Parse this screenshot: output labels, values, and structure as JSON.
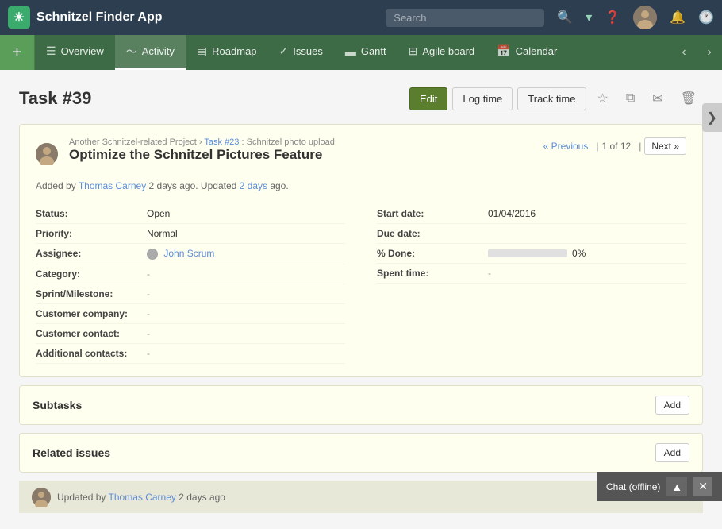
{
  "app": {
    "title": "Schnitzel Finder App"
  },
  "topnav": {
    "search_placeholder": "Search"
  },
  "secnav": {
    "items": [
      {
        "label": "Overview",
        "icon": "☰",
        "active": false
      },
      {
        "label": "Activity",
        "icon": "〜",
        "active": true
      },
      {
        "label": "Roadmap",
        "icon": "▤",
        "active": false
      },
      {
        "label": "Issues",
        "icon": "✓",
        "active": false
      },
      {
        "label": "Gantt",
        "icon": "▬",
        "active": false
      },
      {
        "label": "Agile board",
        "icon": "⊞",
        "active": false
      },
      {
        "label": "Calendar",
        "icon": "📅",
        "active": false
      }
    ]
  },
  "page": {
    "title": "Task #39"
  },
  "actions": {
    "edit_label": "Edit",
    "log_time_label": "Log time",
    "track_time_label": "Track time"
  },
  "task": {
    "project": "Another Schnitzel-related Project",
    "related_task_id": "Task #23",
    "related_task_text": "Schnitzel photo upload",
    "title": "Optimize the Schnitzel Pictures Feature",
    "added_by": "Thomas Carney",
    "added_days": "2 days",
    "updated_days": "2 days",
    "fields": {
      "status_label": "Status:",
      "status_value": "Open",
      "priority_label": "Priority:",
      "priority_value": "Normal",
      "assignee_label": "Assignee:",
      "assignee_value": "John Scrum",
      "category_label": "Category:",
      "category_value": "-",
      "sprint_label": "Sprint/Milestone:",
      "sprint_value": "-",
      "customer_company_label": "Customer company:",
      "customer_company_value": "-",
      "customer_contact_label": "Customer contact:",
      "customer_contact_value": "-",
      "additional_contacts_label": "Additional contacts:",
      "additional_contacts_value": "-",
      "start_date_label": "Start date:",
      "start_date_value": "01/04/2016",
      "due_date_label": "Due date:",
      "due_date_value": "",
      "percent_done_label": "% Done:",
      "percent_done_value": "0%",
      "spent_time_label": "Spent time:",
      "spent_time_value": "-"
    },
    "pagination": {
      "prev_label": "« Previous",
      "info": "1 of 12",
      "next_label": "Next »"
    }
  },
  "subtasks": {
    "title": "Subtasks",
    "add_label": "Add"
  },
  "related_issues": {
    "title": "Related issues",
    "add_label": "Add"
  },
  "footer": {
    "updated_by": "Thomas Carney",
    "updated_days": "2 days",
    "text_prefix": "Updated by",
    "text_suffix": "ago"
  },
  "chat": {
    "label": "Chat (offline)"
  },
  "right_panel": {
    "icon": "❯"
  }
}
